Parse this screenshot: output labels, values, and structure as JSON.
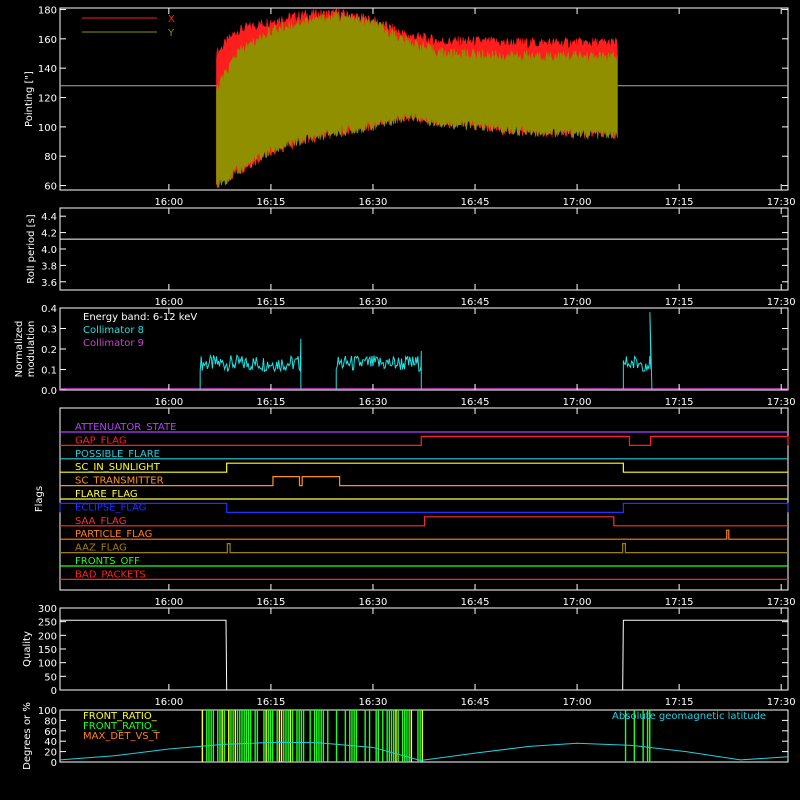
{
  "chart_data": [
    {
      "type": "line",
      "panel": "pointing",
      "ylabel": "Pointing [\"]",
      "ylim": [
        57,
        181
      ],
      "yticks": [
        60,
        80,
        100,
        120,
        140,
        160,
        180
      ],
      "xlim": [
        "15:44",
        "17:31"
      ],
      "xticks": [
        "16:00",
        "16:15",
        "16:30",
        "16:45",
        "17:00",
        "17:15",
        "17:30"
      ],
      "legend": [
        "X",
        "Y"
      ],
      "legend_placement": "top-left",
      "reference_line": 128,
      "data_span": [
        "16:07",
        "17:06"
      ],
      "series": [
        {
          "name": "X",
          "color": "#ff1e1e",
          "x": [
            "16:07",
            "16:10",
            "16:15",
            "16:20",
            "16:25",
            "16:30",
            "16:35",
            "16:40",
            "16:45",
            "16:50",
            "16:55",
            "17:00",
            "17:06"
          ],
          "upper": [
            150,
            165,
            172,
            176,
            177,
            172,
            162,
            158,
            158,
            157,
            157,
            157,
            157
          ],
          "lower": [
            60,
            70,
            84,
            92,
            97,
            101,
            108,
            103,
            101,
            98,
            97,
            96,
            95
          ]
        },
        {
          "name": "Y",
          "color": "#8f8f00",
          "x": [
            "16:07",
            "16:10",
            "16:15",
            "16:20",
            "16:25",
            "16:30",
            "16:35",
            "16:40",
            "16:45",
            "16:50",
            "16:55",
            "17:00",
            "17:06"
          ],
          "upper": [
            125,
            150,
            165,
            172,
            175,
            170,
            158,
            150,
            149,
            148,
            148,
            148,
            147
          ],
          "lower": [
            60,
            70,
            84,
            92,
            97,
            101,
            108,
            103,
            101,
            98,
            97,
            96,
            95
          ]
        }
      ]
    },
    {
      "type": "line",
      "panel": "roll",
      "ylabel": "Roll period [s]",
      "ylim": [
        3.5,
        4.5
      ],
      "yticks": [
        3.6,
        3.8,
        4.0,
        4.2,
        4.4
      ],
      "xticks": [
        "16:00",
        "16:15",
        "16:30",
        "16:45",
        "17:00",
        "17:15",
        "17:30"
      ],
      "series": [
        {
          "color": "#ffffff",
          "x": [
            "15:44",
            "17:31"
          ],
          "y": [
            4.12,
            4.12
          ]
        }
      ]
    },
    {
      "type": "line",
      "panel": "modulation",
      "ylabel": [
        "Normalized",
        "modulation"
      ],
      "ylim": [
        0,
        0.4
      ],
      "yticks": [
        0.0,
        0.1,
        0.2,
        0.3,
        0.4
      ],
      "xticks": [
        "16:00",
        "16:15",
        "16:30",
        "16:45",
        "17:00",
        "17:15",
        "17:30"
      ],
      "annotation": "Energy band: 6-12 keV",
      "legend_placement": "top-left",
      "series": [
        {
          "name": "Collimator 8",
          "color": "#22e0e0",
          "segments": [
            {
              "start": "16:04.6",
              "end": "16:19.4",
              "level": 0.13,
              "spikes": [
                [
                  "16:19.4",
                  0.25
                ]
              ]
            },
            {
              "start": "16:24.6",
              "end": "16:37.1",
              "level": 0.13,
              "spikes": [
                [
                  "16:37.1",
                  0.19
                ]
              ]
            },
            {
              "start": "17:06.8",
              "end": "17:11.0",
              "level": 0.13,
              "spikes": [
                [
                  "17:10.7",
                  0.38
                ]
              ]
            }
          ]
        },
        {
          "name": "Collimator 9",
          "color": "#d040d0",
          "x": [
            "15:44",
            "17:31"
          ],
          "y": [
            0.0,
            0.0
          ]
        }
      ]
    },
    {
      "type": "line",
      "panel": "flags",
      "ylabel": "Flags",
      "xticks": [
        "16:00",
        "16:15",
        "16:30",
        "16:45",
        "17:00",
        "17:15",
        "17:30"
      ],
      "series": [
        {
          "name": "ATTENUATOR_STATE",
          "color": "#b040ff",
          "steps": []
        },
        {
          "name": "GAP_FLAG",
          "color": "#ff2020",
          "steps": [
            [
              "16:37.1",
              "17:07.7"
            ],
            [
              "17:10.8",
              "17:31"
            ]
          ]
        },
        {
          "name": "POSSIBLE_FLARE",
          "color": "#20d0e0",
          "steps": []
        },
        {
          "name": "SC_IN_SUNLIGHT",
          "color": "#ffff20",
          "steps": [
            [
              "16:08.5",
              "17:06.8"
            ]
          ]
        },
        {
          "name": "SC_TRANSMITTER",
          "color": "#ff9020",
          "steps": [
            [
              "16:15.3",
              "16:19.2"
            ],
            [
              "16:19.6",
              "16:25.1"
            ]
          ]
        },
        {
          "name": "FLARE_FLAG",
          "color": "#ffff40",
          "steps": []
        },
        {
          "name": "ECLIPSE_FLAG",
          "color": "#2030ff",
          "steps": [
            [
              "15:44",
              "16:08.5"
            ],
            [
              "17:06.8",
              "17:31"
            ]
          ]
        },
        {
          "name": "SAA_FLAG",
          "color": "#ff3030",
          "steps": [
            [
              "16:37.6",
              "17:05.4"
            ]
          ]
        },
        {
          "name": "PARTICLE_FLAG",
          "color": "#ff8020",
          "steps": [
            [
              "17:22.0",
              "17:22.3"
            ]
          ]
        },
        {
          "name": "AAZ_FLAG",
          "color": "#a08000",
          "steps": [
            [
              "16:08.6",
              "16:09.0"
            ],
            [
              "17:06.7",
              "17:07.1"
            ]
          ]
        },
        {
          "name": "FRONTS_OFF",
          "color": "#20ff20",
          "steps": []
        },
        {
          "name": "BAD_PACKETS",
          "color": "#ff2020",
          "steps": []
        }
      ]
    },
    {
      "type": "line",
      "panel": "quality",
      "ylabel": "Quality",
      "ylim": [
        0,
        300
      ],
      "yticks": [
        0,
        50,
        100,
        150,
        200,
        250,
        300
      ],
      "xticks": [
        "16:00",
        "16:15",
        "16:30",
        "16:45",
        "17:00",
        "17:15",
        "17:30"
      ],
      "series": [
        {
          "color": "#ffffff",
          "x": [
            "15:44",
            "16:08.4",
            "16:08.5",
            "17:06.7",
            "17:06.8",
            "17:31"
          ],
          "y": [
            255,
            255,
            0,
            0,
            255,
            255
          ]
        }
      ]
    },
    {
      "type": "line",
      "panel": "geomagnetic",
      "ylabel": "Degrees or %",
      "ylim": [
        0,
        100
      ],
      "yticks": [
        0,
        20,
        40,
        60,
        80,
        100
      ],
      "xticks": [
        "16:00",
        "16:15",
        "16:30",
        "16:45",
        "17:00",
        "17:15",
        "17:30"
      ],
      "legend_left": [
        "FRONT_RATIO_",
        "FRONT_RATIO_",
        "MAX_DET_VS_T"
      ],
      "series": [
        {
          "name": "FRONT_RATIO_",
          "color": "#ffff20",
          "bands": [
            [
              "16:04.6",
              "16:37.3"
            ],
            [
              "17:06.8",
              "17:11.0"
            ]
          ],
          "value": 100
        },
        {
          "name": "FRONT_RATIO_",
          "color": "#20ff20",
          "bands": [
            [
              "16:04.6",
              "16:37.3"
            ],
            [
              "17:06.8",
              "17:11.0"
            ]
          ],
          "value": 100
        },
        {
          "name": "MAX_DET_VS_T",
          "color": "#ff8020",
          "bands": [],
          "value": 0
        },
        {
          "name": "Absolute geomagnetic latitude",
          "color": "#20d0e0",
          "x": [
            "15:44",
            "15:52",
            "16:00",
            "16:08",
            "16:16",
            "16:22",
            "16:30",
            "16:37",
            "16:45",
            "16:53",
            "17:00",
            "17:08",
            "17:16",
            "17:24",
            "17:31"
          ],
          "y": [
            4,
            12,
            25,
            34,
            38,
            37,
            28,
            3,
            17,
            30,
            36,
            32,
            20,
            4,
            10
          ]
        }
      ]
    }
  ]
}
